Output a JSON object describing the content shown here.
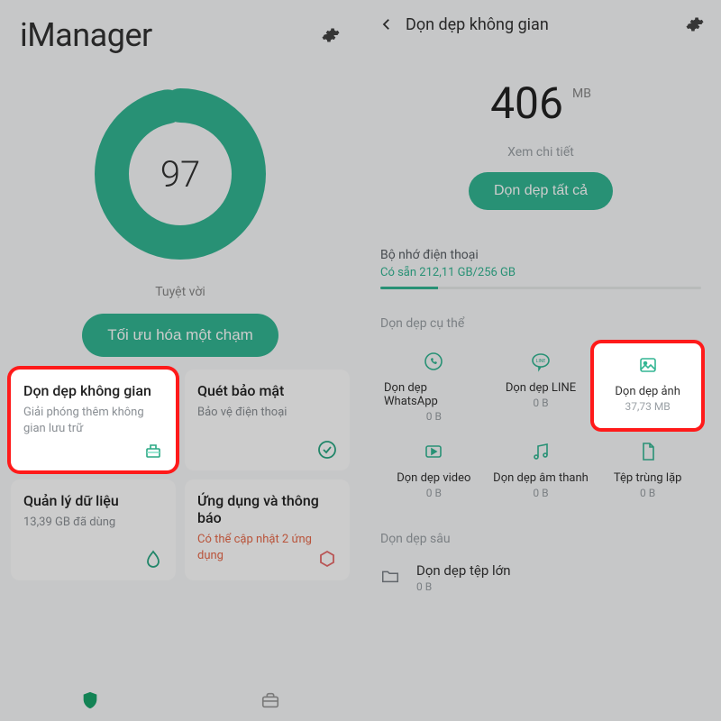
{
  "left": {
    "app_title": "iManager",
    "score": "97",
    "score_caption": "Tuyệt vời",
    "optimize_label": "Tối ưu hóa một chạm",
    "tiles": [
      {
        "title": "Dọn dẹp không gian",
        "sub": "Giải phóng thêm không gian lưu trữ"
      },
      {
        "title": "Quét bảo mật",
        "sub": "Bảo vệ điện thoại"
      },
      {
        "title": "Quản lý dữ liệu",
        "sub": "13,39 GB đã dùng"
      },
      {
        "title": "Ứng dụng và thông báo",
        "sub": "Có thể cập nhật 2 ứng dụng"
      }
    ]
  },
  "right": {
    "title": "Dọn dẹp không gian",
    "size": "406",
    "unit": "MB",
    "detail_label": "Xem chi tiết",
    "clean_all_label": "Dọn dẹp tất cả",
    "storage": {
      "title": "Bộ nhớ điện thoại",
      "sub": "Có sẵn 212,11 GB/256 GB",
      "pct": 18
    },
    "specific_label": "Dọn dẹp cụ thể",
    "options": [
      {
        "title": "Dọn dẹp WhatsApp",
        "sub": "0 B"
      },
      {
        "title": "Dọn dẹp LINE",
        "sub": "0 B"
      },
      {
        "title": "Dọn dẹp ảnh",
        "sub": "37,73 MB"
      },
      {
        "title": "Dọn dẹp video",
        "sub": "0 B"
      },
      {
        "title": "Dọn dẹp âm thanh",
        "sub": "0 B"
      },
      {
        "title": "Tệp trùng lặp",
        "sub": "0 B"
      }
    ],
    "deep_label": "Dọn dẹp sâu",
    "deep": {
      "title": "Dọn dẹp tệp lớn",
      "sub": "0 B"
    }
  }
}
